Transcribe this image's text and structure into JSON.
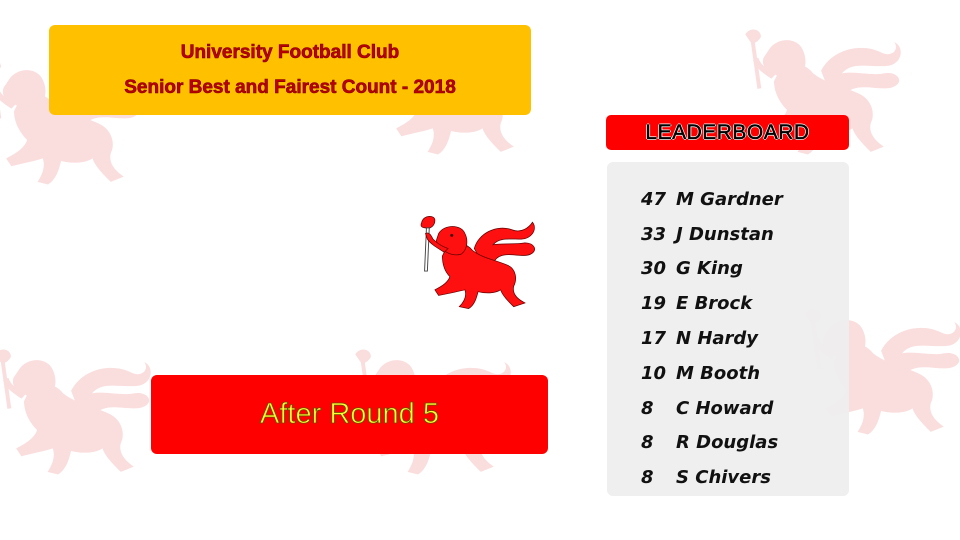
{
  "header": {
    "club_name": "University Football Club",
    "subtitle": "Senior Best and Fairest Count - 2018"
  },
  "round_banner": {
    "label": "After Round 5"
  },
  "leaderboard": {
    "title": "LEADERBOARD",
    "entries": [
      {
        "votes": "47",
        "name": "M Gardner"
      },
      {
        "votes": "33",
        "name": "J Dunstan"
      },
      {
        "votes": "30",
        "name": "G King"
      },
      {
        "votes": "19",
        "name": "E Brock"
      },
      {
        "votes": "17",
        "name": "N Hardy"
      },
      {
        "votes": "10",
        "name": "M Booth"
      },
      {
        "votes": "8",
        "name": "C Howard"
      },
      {
        "votes": "8",
        "name": "R Douglas"
      },
      {
        "votes": "8",
        "name": "S Chivers"
      }
    ]
  },
  "logo": {
    "icon": "red-lion-with-torch-icon"
  },
  "background": {
    "icon": "lion-watermark-pattern"
  },
  "colors": {
    "title_box": "#ffc000",
    "title_text": "#c00000",
    "banner_red": "#ff0000",
    "banner_text": "#ffff33",
    "panel": "#eeeeee"
  }
}
